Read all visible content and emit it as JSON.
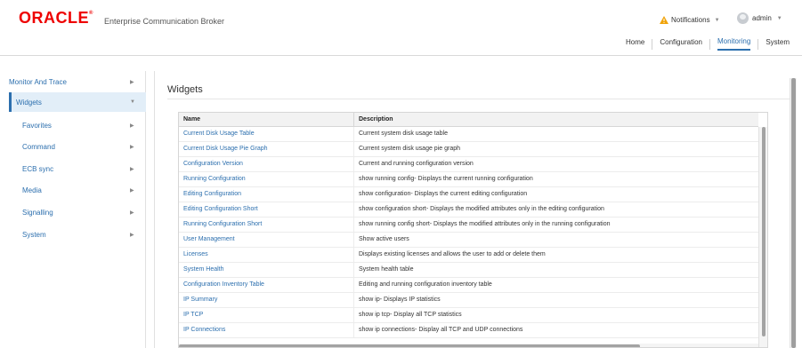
{
  "header": {
    "logo_text": "ORACLE",
    "logo_mark": "®",
    "app_name": "Enterprise Communication Broker",
    "notifications_label": "Notifications",
    "user_label": "admin",
    "warning_color": "#f0a30a",
    "nav": [
      {
        "label": "Home",
        "active": false
      },
      {
        "label": "Configuration",
        "active": false
      },
      {
        "label": "Monitoring",
        "active": true
      },
      {
        "label": "System",
        "active": false
      }
    ]
  },
  "sidebar": {
    "items": [
      {
        "label": "Monitor And Trace",
        "chevron": "▶",
        "active": false,
        "child": false
      },
      {
        "label": "Widgets",
        "chevron": "▼",
        "active": true,
        "child": false
      },
      {
        "label": "Favorites",
        "chevron": "▶",
        "active": false,
        "child": true
      },
      {
        "label": "Command",
        "chevron": "▶",
        "active": false,
        "child": true
      },
      {
        "label": "ECB sync",
        "chevron": "▶",
        "active": false,
        "child": true
      },
      {
        "label": "Media",
        "chevron": "▶",
        "active": false,
        "child": true
      },
      {
        "label": "Signalling",
        "chevron": "▶",
        "active": false,
        "child": true
      },
      {
        "label": "System",
        "chevron": "▶",
        "active": false,
        "child": true
      }
    ]
  },
  "main": {
    "title": "Widgets",
    "table": {
      "headers": [
        "Name",
        "Description"
      ],
      "rows": [
        [
          "Current Disk Usage Table",
          "Current system disk usage table"
        ],
        [
          "Current Disk Usage Pie Graph",
          "Current system disk usage pie graph"
        ],
        [
          "Configuration Version",
          "Current and running configuration version"
        ],
        [
          "Running Configuration",
          "show running config- Displays the current running configuration"
        ],
        [
          "Editing Configuration",
          "show configuration- Displays the current editing configuration"
        ],
        [
          "Editing Configuration Short",
          "show configuration short- Displays the modified attributes only in the editing configuration"
        ],
        [
          "Running Configuration Short",
          "show running config short- Displays the modified attributes only in the running configuration"
        ],
        [
          "User Management",
          "Show active users"
        ],
        [
          "Licenses",
          "Displays existing licenses and allows the user to add or delete them"
        ],
        [
          "System Health",
          "System health table"
        ],
        [
          "Configuration Inventory Table",
          "Editing and running configuration inventory table"
        ],
        [
          "IP Summary",
          "show ip- Displays IP statistics"
        ],
        [
          "IP TCP",
          "show ip tcp- Display all TCP statistics"
        ],
        [
          "IP Connections",
          "show ip connections- Display all TCP and UDP connections"
        ]
      ]
    }
  },
  "colors": {
    "brand": "#e00000",
    "link": "#2c6fae",
    "active_bg": "#e2eef8"
  }
}
